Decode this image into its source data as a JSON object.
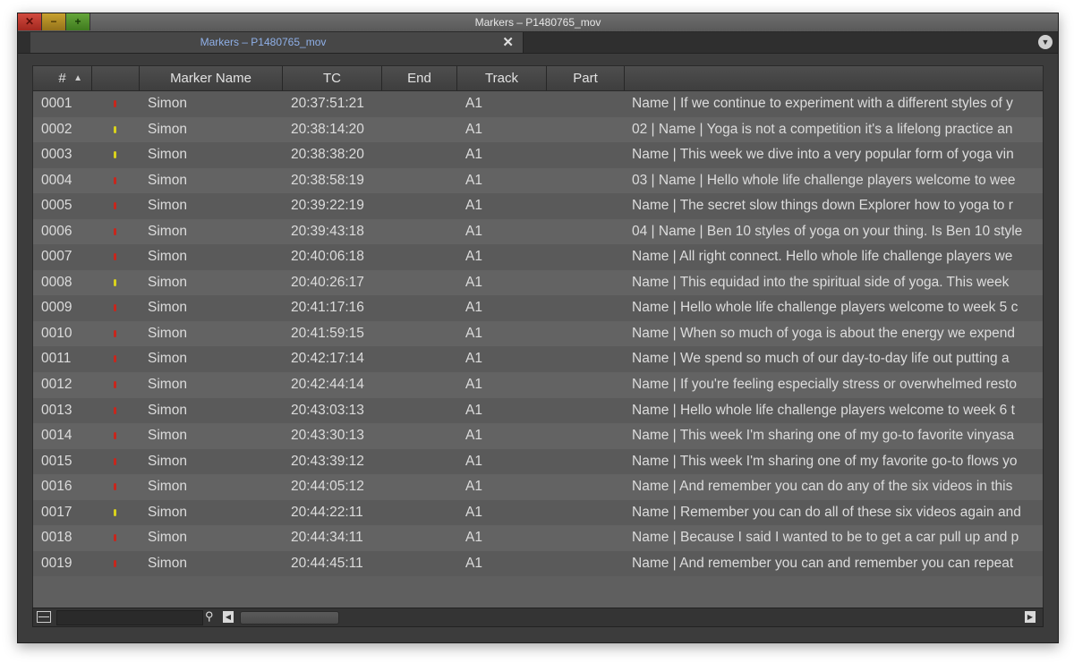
{
  "window": {
    "title": "Markers – P1480765_mov"
  },
  "tab": {
    "label": "Markers – P1480765_mov",
    "close_glyph": "✕"
  },
  "columns": {
    "num": "#",
    "color": "",
    "name": "Marker Name",
    "tc": "TC",
    "end": "End",
    "track": "Track",
    "part": "Part",
    "comment": ""
  },
  "colors": {
    "red": "#c8261c",
    "yellow": "#d9d21c"
  },
  "rows": [
    {
      "num": "0001",
      "color": "red",
      "name": "Simon",
      "tc": "20:37:51:21",
      "end": "",
      "track": "A1",
      "part": "",
      "comment": "Name | If we continue to experiment with a different styles of y"
    },
    {
      "num": "0002",
      "color": "yellow",
      "name": "Simon",
      "tc": "20:38:14:20",
      "end": "",
      "track": "A1",
      "part": "",
      "comment": "02 | Name | Yoga is not a competition it's a lifelong practice an"
    },
    {
      "num": "0003",
      "color": "yellow",
      "name": "Simon",
      "tc": "20:38:38:20",
      "end": "",
      "track": "A1",
      "part": "",
      "comment": "Name | This week we dive into a very popular form of yoga vin"
    },
    {
      "num": "0004",
      "color": "red",
      "name": "Simon",
      "tc": "20:38:58:19",
      "end": "",
      "track": "A1",
      "part": "",
      "comment": "03 | Name | Hello whole life challenge players welcome to wee"
    },
    {
      "num": "0005",
      "color": "red",
      "name": "Simon",
      "tc": "20:39:22:19",
      "end": "",
      "track": "A1",
      "part": "",
      "comment": "Name | The secret slow things down Explorer how to yoga to r"
    },
    {
      "num": "0006",
      "color": "red",
      "name": "Simon",
      "tc": "20:39:43:18",
      "end": "",
      "track": "A1",
      "part": "",
      "comment": "04 | Name | Ben 10 styles of yoga on your thing. Is Ben 10 style"
    },
    {
      "num": "0007",
      "color": "red",
      "name": "Simon",
      "tc": "20:40:06:18",
      "end": "",
      "track": "A1",
      "part": "",
      "comment": "Name | All right connect. Hello whole life challenge players we"
    },
    {
      "num": "0008",
      "color": "yellow",
      "name": "Simon",
      "tc": "20:40:26:17",
      "end": "",
      "track": "A1",
      "part": "",
      "comment": "Name | This equidad into the spiritual side of yoga. This week"
    },
    {
      "num": "0009",
      "color": "red",
      "name": "Simon",
      "tc": "20:41:17:16",
      "end": "",
      "track": "A1",
      "part": "",
      "comment": "Name | Hello whole life challenge players welcome to week 5 c"
    },
    {
      "num": "0010",
      "color": "red",
      "name": "Simon",
      "tc": "20:41:59:15",
      "end": "",
      "track": "A1",
      "part": "",
      "comment": "Name | When so much of yoga is about the energy we expend"
    },
    {
      "num": "0011",
      "color": "red",
      "name": "Simon",
      "tc": "20:42:17:14",
      "end": "",
      "track": "A1",
      "part": "",
      "comment": "Name | We spend so much of our day-to-day life out putting a"
    },
    {
      "num": "0012",
      "color": "red",
      "name": "Simon",
      "tc": "20:42:44:14",
      "end": "",
      "track": "A1",
      "part": "",
      "comment": "Name | If you're feeling especially stress or overwhelmed resto"
    },
    {
      "num": "0013",
      "color": "red",
      "name": "Simon",
      "tc": "20:43:03:13",
      "end": "",
      "track": "A1",
      "part": "",
      "comment": "Name | Hello whole life challenge players welcome to week 6 t"
    },
    {
      "num": "0014",
      "color": "red",
      "name": "Simon",
      "tc": "20:43:30:13",
      "end": "",
      "track": "A1",
      "part": "",
      "comment": "Name | This week I'm sharing one of my go-to favorite vinyasa"
    },
    {
      "num": "0015",
      "color": "red",
      "name": "Simon",
      "tc": "20:43:39:12",
      "end": "",
      "track": "A1",
      "part": "",
      "comment": "Name | This week I'm sharing one of my favorite go-to flows yo"
    },
    {
      "num": "0016",
      "color": "red",
      "name": "Simon",
      "tc": "20:44:05:12",
      "end": "",
      "track": "A1",
      "part": "",
      "comment": "Name | And remember you can do any of the six videos in this"
    },
    {
      "num": "0017",
      "color": "yellow",
      "name": "Simon",
      "tc": "20:44:22:11",
      "end": "",
      "track": "A1",
      "part": "",
      "comment": "Name | Remember you can do all of these six videos again and"
    },
    {
      "num": "0018",
      "color": "red",
      "name": "Simon",
      "tc": "20:44:34:11",
      "end": "",
      "track": "A1",
      "part": "",
      "comment": "Name | Because I said I wanted to be to get a car pull up and p"
    },
    {
      "num": "0019",
      "color": "red",
      "name": "Simon",
      "tc": "20:44:45:11",
      "end": "",
      "track": "A1",
      "part": "",
      "comment": "Name | And remember you can and remember you can repeat"
    }
  ],
  "bottom": {
    "search_placeholder": ""
  }
}
